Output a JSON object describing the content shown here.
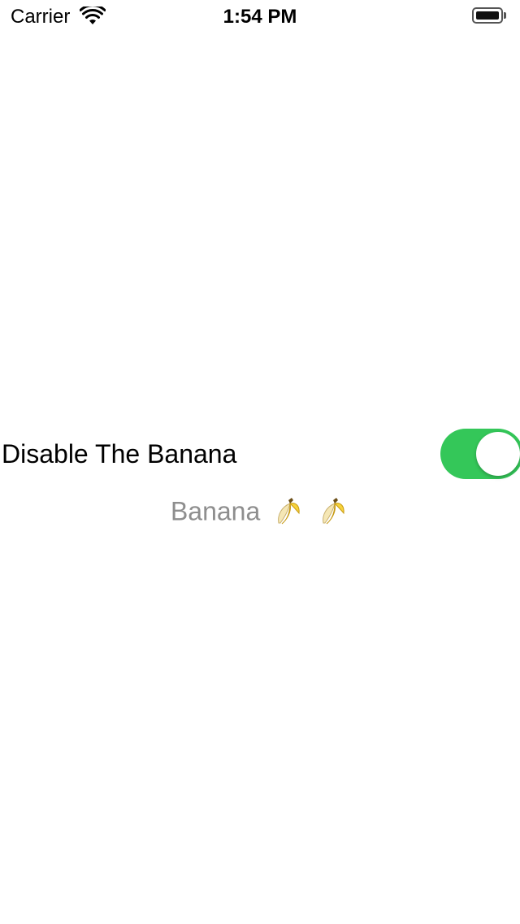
{
  "status_bar": {
    "carrier": "Carrier",
    "time": "1:54 PM",
    "wifi_icon": "wifi-icon",
    "battery_icon": "battery-icon"
  },
  "toggle": {
    "label": "Disable The Banana",
    "is_on": true,
    "on_color": "#34c759"
  },
  "banana": {
    "text": "Banana",
    "emoji_icon": "banana-emoji-icon",
    "emoji_count": 2,
    "text_color": "#8e8e8e"
  }
}
